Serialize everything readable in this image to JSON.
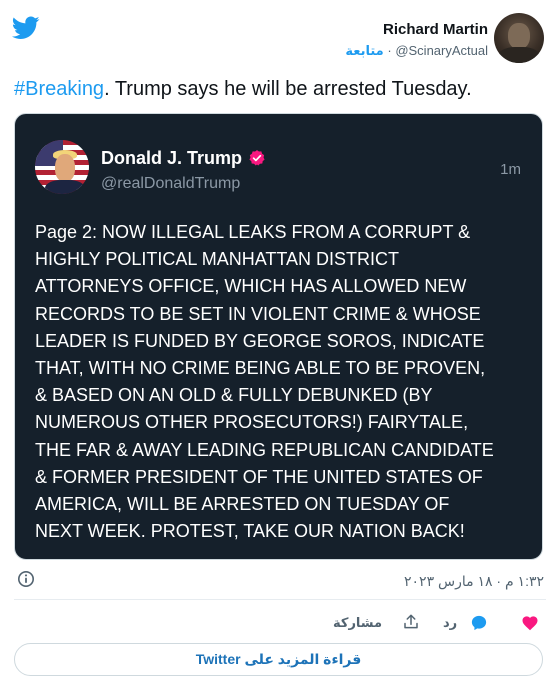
{
  "author": {
    "name": "Richard Martin",
    "handle": "@ScinaryActual",
    "follow_label": "متابعة",
    "separator": "·"
  },
  "tweet": {
    "hashtag": "#Breaking",
    "text": ". Trump says he will be arrested Tuesday."
  },
  "embedded_post": {
    "name": "Donald J. Trump",
    "handle": "@realDonaldTrump",
    "time": "1m",
    "body_lines": [
      "Page 2: NOW ILLEGAL LEAKS FROM A CORRUPT &",
      "HIGHLY POLITICAL MANHATTAN DISTRICT",
      "ATTORNEYS OFFICE, WHICH HAS ALLOWED NEW",
      "RECORDS TO BE SET IN VIOLENT CRIME & WHOSE",
      "LEADER IS FUNDED BY GEORGE SOROS, INDICATE",
      "THAT, WITH NO CRIME BEING ABLE TO BE PROVEN,",
      "& BASED ON AN OLD & FULLY DEBUNKED (BY",
      "NUMEROUS OTHER PROSECUTORS!) FAIRYTALE,",
      "THE FAR & AWAY LEADING REPUBLICAN CANDIDATE",
      "& FORMER PRESIDENT OF THE UNITED STATES OF",
      "AMERICA, WILL BE ARRESTED ON TUESDAY OF",
      "NEXT WEEK. PROTEST, TAKE OUR NATION BACK!"
    ]
  },
  "meta": {
    "timestamp": "١:٣٢ م · ١٨ مارس ٢٠٢٣"
  },
  "actions": {
    "reply_label": "رد",
    "share_label": "مشاركة"
  },
  "read_more_label": "قراءة المزيد على Twitter",
  "colors": {
    "accent": "#1d9bf0",
    "heart": "#f91880",
    "embed_bg": "#15202b",
    "verified": "#f91880"
  },
  "icons": {
    "brand": "twitter-bird-icon",
    "info": "info-icon",
    "like": "heart-icon",
    "reply": "reply-bubble-icon",
    "share": "share-upload-icon",
    "verified": "verified-badge-icon"
  }
}
